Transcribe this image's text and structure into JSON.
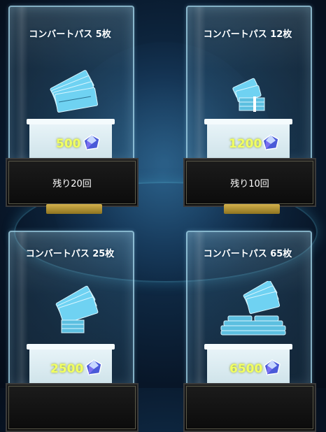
{
  "colors": {
    "price_text": "#f2ff60",
    "panel_background": "#111111",
    "gold_tab": "#c9a83f",
    "case_border": "#aadcef"
  },
  "cards": [
    {
      "title": "コンバートパス 5枚",
      "price": "500",
      "remaining": "残り20回",
      "icon": "ticket-bundle-icon"
    },
    {
      "title": "コンバートパス 12枚",
      "price": "1200",
      "remaining": "残り10回",
      "icon": "ticket-stack-icon"
    },
    {
      "title": "コンバートパス 25枚",
      "price": "2500",
      "icon": "ticket-bundle-icon"
    },
    {
      "title": "コンバートパス 65枚",
      "price": "6500",
      "icon": "ticket-pile-icon"
    }
  ],
  "currency_icon": "crystal-gem-icon"
}
